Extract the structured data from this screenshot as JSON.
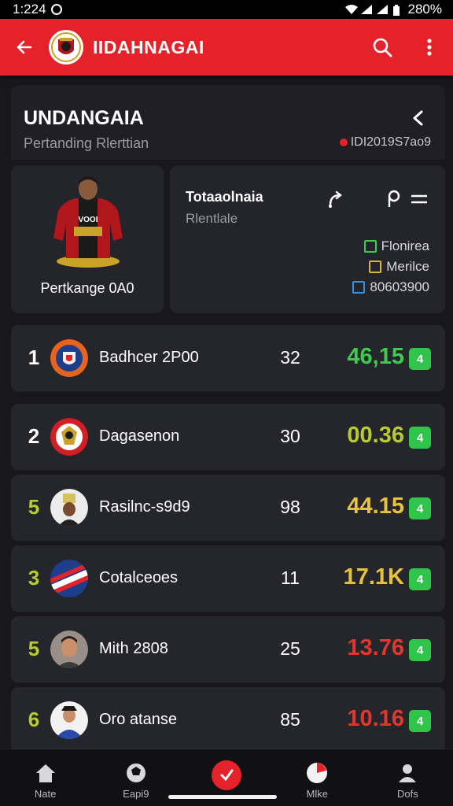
{
  "status_bar": {
    "time": "1:224",
    "battery": "280%"
  },
  "app_bar": {
    "title": "IIDAHNAGAI"
  },
  "header": {
    "title": "UNDANGAIA",
    "subtitle": "Pertanding Rlerttian",
    "meta": "IDI2019S7ao9"
  },
  "player_card": {
    "caption": "Pertkange 0A0",
    "jersey_text": "VOOI"
  },
  "stats_card": {
    "title": "Totaaolnaia",
    "subtitle": "Rlentlale",
    "legend": [
      {
        "label": "Flonirea",
        "color": "#3ccb4f"
      },
      {
        "label": "Merilce",
        "color": "#e0b53a"
      },
      {
        "label": "80603900",
        "color": "#3b8fe0"
      }
    ]
  },
  "rows": [
    {
      "rank": "1",
      "rank_color": "#ffffff",
      "name": "Badhcer 2P00",
      "value": "32",
      "score": "46,15",
      "score_color": "#3ccb4f",
      "badge": "4",
      "avatar": "crest-orange"
    },
    {
      "rank": "2",
      "rank_color": "#ffffff",
      "name": "Dagasenon",
      "value": "30",
      "score": "00.36",
      "score_color": "#b9cc2f",
      "badge": "4",
      "avatar": "crest-red"
    },
    {
      "rank": "5",
      "rank_color": "#b9cc2f",
      "name": "Rasilnc-s9d9",
      "value": "98",
      "score": "44.15",
      "score_color": "#e8c23a",
      "badge": "4",
      "avatar": "person-hat"
    },
    {
      "rank": "3",
      "rank_color": "#b9cc2f",
      "name": "Cotalceoes",
      "value": "11",
      "score": "17.1K",
      "score_color": "#e8c23a",
      "badge": "4",
      "avatar": "crest-stripes"
    },
    {
      "rank": "5",
      "rank_color": "#b9cc2f",
      "name": "Mith 2808",
      "value": "25",
      "score": "13.76",
      "score_color": "#e2372f",
      "badge": "4",
      "avatar": "person-face"
    },
    {
      "rank": "6",
      "rank_color": "#b9cc2f",
      "name": "Oro atanse",
      "value": "85",
      "score": "10.16",
      "score_color": "#e2372f",
      "badge": "4",
      "avatar": "person-blue"
    }
  ],
  "bottom_nav": [
    {
      "label": "Nate",
      "icon": "home-icon"
    },
    {
      "label": "Eapi9",
      "icon": "ball-icon"
    },
    {
      "label": "",
      "icon": "center-action-icon"
    },
    {
      "label": "Mlke",
      "icon": "chart-pie-icon"
    },
    {
      "label": "Dofs",
      "icon": "profile-icon"
    }
  ],
  "colors": {
    "accent": "#e5222a",
    "background": "#17171c",
    "card": "#25252c"
  }
}
